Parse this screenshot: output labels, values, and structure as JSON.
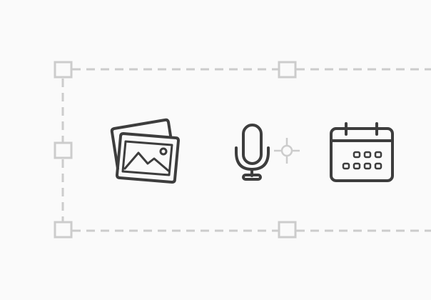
{
  "canvas": {
    "background": "#fafafa",
    "selection_color": "#cccccc",
    "icon_color": "#3d3d3d"
  },
  "selection": {
    "style": "dashed",
    "handles": [
      "top-left",
      "top-center",
      "middle-left",
      "bottom-left",
      "bottom-center"
    ],
    "pivot": "crosshair"
  },
  "icons": [
    {
      "name": "image-gallery-icon"
    },
    {
      "name": "microphone-icon"
    },
    {
      "name": "calendar-icon"
    }
  ]
}
